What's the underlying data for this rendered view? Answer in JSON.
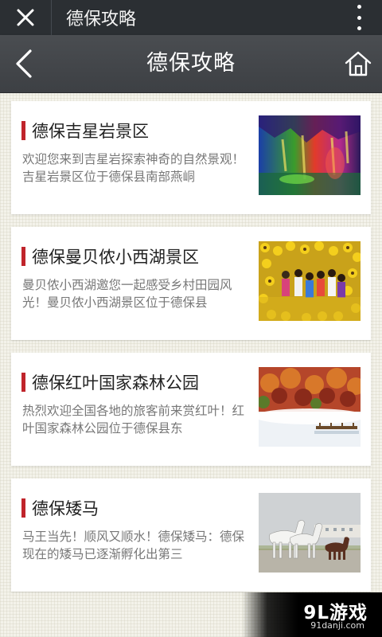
{
  "browser": {
    "title": "德保攻略",
    "close_icon": "close-icon",
    "more_icon": "more-vertical-icon"
  },
  "header": {
    "title": "德保攻略",
    "back_icon": "back-arrow-icon",
    "home_icon": "home-icon"
  },
  "articles": [
    {
      "title": "德保吉星岩景区",
      "desc": "欢迎您来到吉星岩探索神奇的自然景观！吉星岩景区位于德保县南部燕峒",
      "image": "cave-photo"
    },
    {
      "title": "德保曼贝侬小西湖景区",
      "desc": "曼贝侬小西湖邀您一起感受乡村田园风光！曼贝侬小西湖景区位于德保县",
      "image": "sunflower-field-photo"
    },
    {
      "title": "德保红叶国家森林公园",
      "desc": "热烈欢迎全国各地的旅客前来赏红叶！红叶国家森林公园位于德保县东",
      "image": "forest-lake-photo"
    },
    {
      "title": "德保矮马",
      "desc": "马王当先！顺风又顺水！德保矮马：德保现在的矮马已逐渐孵化出第三",
      "image": "horses-photo"
    }
  ],
  "watermark": {
    "logo": "9L游戏",
    "url": "91danji.com"
  },
  "colors": {
    "accent": "#c0242b",
    "header_bg": "#414448",
    "topbar_bg": "#2b2f33"
  }
}
